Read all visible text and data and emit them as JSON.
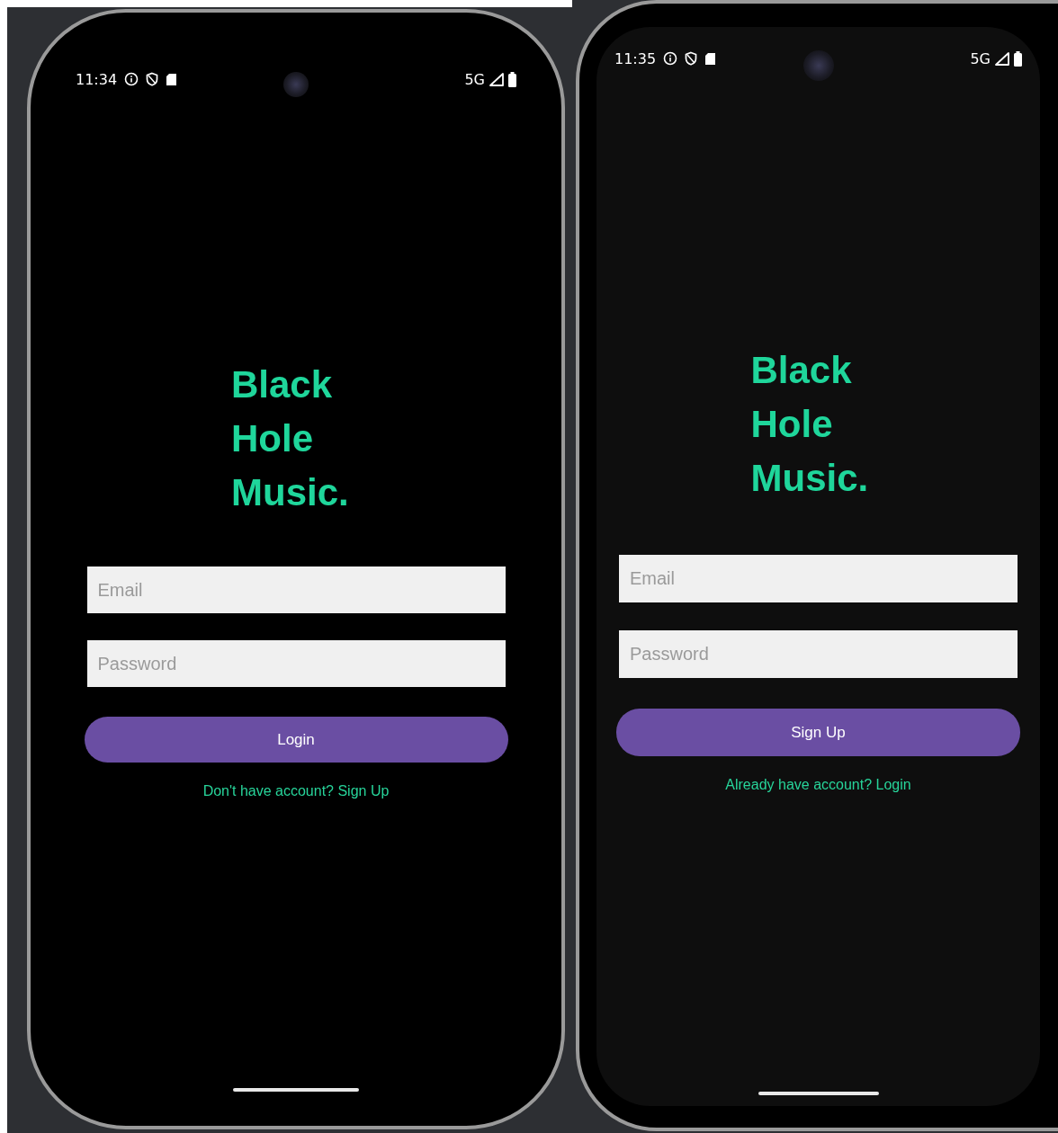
{
  "phones": [
    {
      "status_bar": {
        "time": "11:34",
        "network": "5G"
      },
      "title_lines": [
        "Black",
        "Hole",
        "Music."
      ],
      "fields": [
        {
          "placeholder": "Email"
        },
        {
          "placeholder": "Password"
        }
      ],
      "button": "Login",
      "link": "Don't have account? Sign Up"
    },
    {
      "status_bar": {
        "time": "11:35",
        "network": "5G"
      },
      "title_lines": [
        "Black",
        "Hole",
        "Music."
      ],
      "fields": [
        {
          "placeholder": "Email"
        },
        {
          "placeholder": "Password"
        }
      ],
      "button": "Sign Up",
      "link": "Already have account? Login"
    }
  ]
}
